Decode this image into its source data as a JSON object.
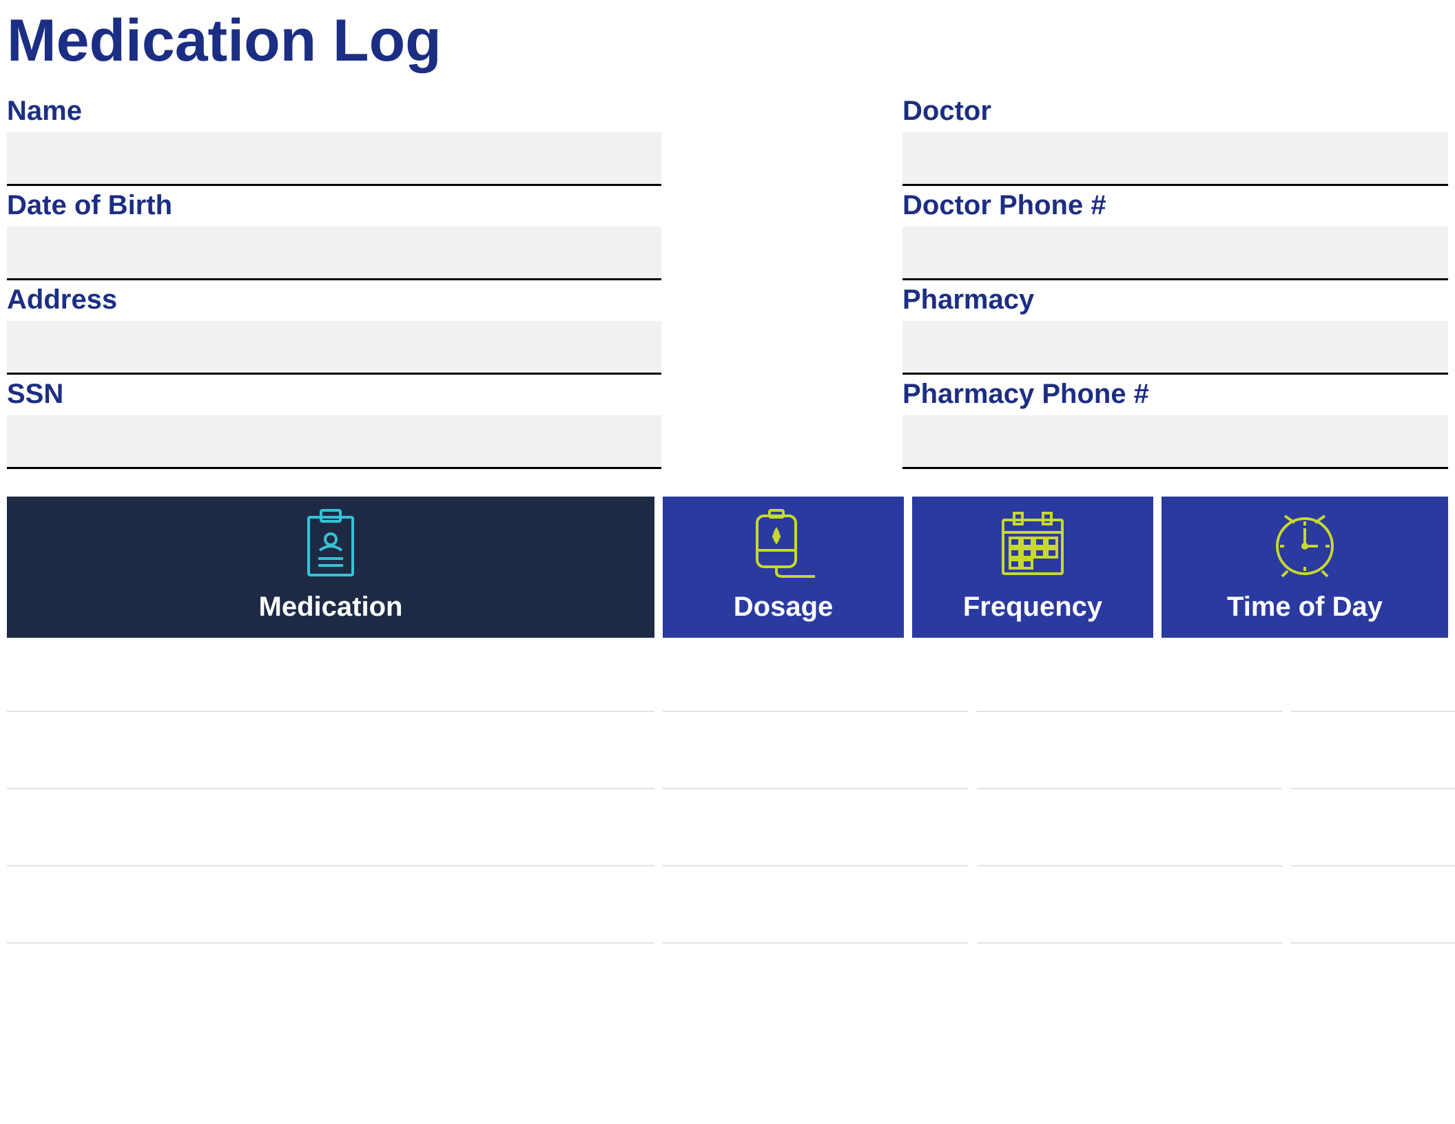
{
  "title": "Medication Log",
  "left_fields": [
    {
      "label": "Name",
      "value": ""
    },
    {
      "label": "Date of Birth",
      "value": ""
    },
    {
      "label": "Address",
      "value": ""
    },
    {
      "label": "SSN",
      "value": ""
    }
  ],
  "right_fields": [
    {
      "label": "Doctor",
      "value": ""
    },
    {
      "label": "Doctor Phone #",
      "value": ""
    },
    {
      "label": "Pharmacy",
      "value": ""
    },
    {
      "label": "Pharmacy Phone #",
      "value": ""
    }
  ],
  "table_headers": [
    "Medication",
    "Dosage",
    "Frequency",
    "Time of Day"
  ],
  "table_rows": [
    [
      "",
      "",
      "",
      ""
    ],
    [
      "",
      "",
      "",
      ""
    ],
    [
      "",
      "",
      "",
      ""
    ],
    [
      "",
      "",
      "",
      ""
    ]
  ],
  "colors": {
    "accent": "#1c2e83",
    "header_dark": "#1e2a44",
    "header_blue": "#2b3aa0",
    "icon_lime": "#c7d92c",
    "icon_cyan": "#35c3d6"
  }
}
